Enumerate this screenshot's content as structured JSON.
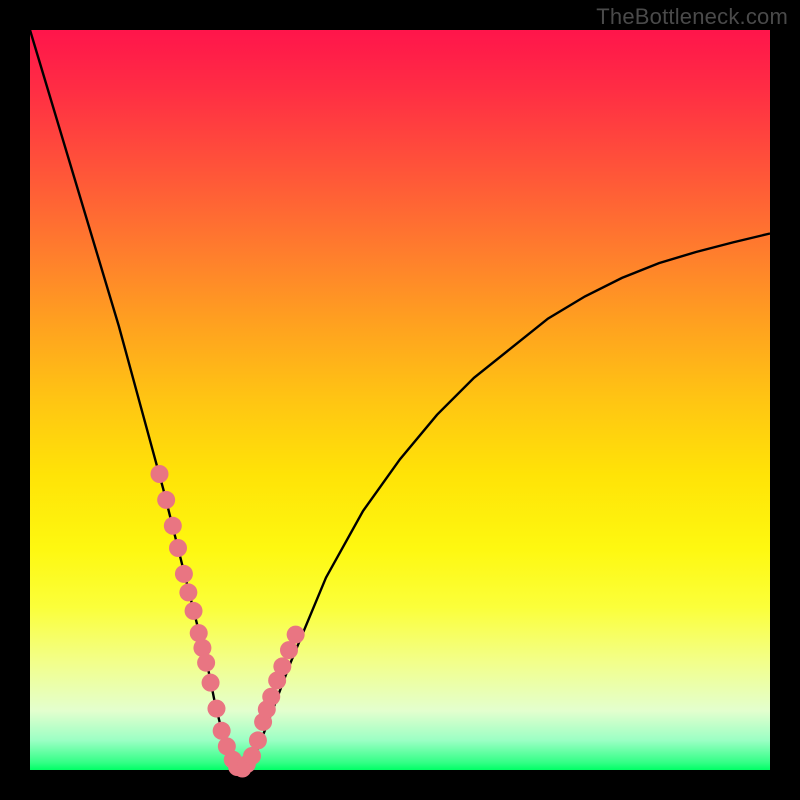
{
  "watermark": "TheBottleneck.com",
  "chart_data": {
    "type": "line",
    "title": "",
    "xlabel": "",
    "ylabel": "",
    "xlim": [
      0,
      100
    ],
    "ylim": [
      0,
      100
    ],
    "curve": {
      "x": [
        0,
        3,
        6,
        9,
        12,
        15,
        18,
        20,
        22,
        24,
        25,
        26,
        27,
        28,
        29,
        30,
        32,
        35,
        40,
        45,
        50,
        55,
        60,
        65,
        70,
        75,
        80,
        85,
        90,
        95,
        100
      ],
      "y": [
        100,
        90,
        80,
        70,
        60,
        49,
        38,
        30,
        22,
        14,
        9,
        5,
        2,
        0,
        0,
        1,
        6,
        14,
        26,
        35,
        42,
        48,
        53,
        57,
        61,
        64,
        66.5,
        68.5,
        70,
        71.3,
        72.5
      ]
    },
    "markers": {
      "x": [
        17.5,
        18.4,
        19.3,
        20.0,
        20.8,
        21.4,
        22.1,
        22.8,
        23.3,
        23.8,
        24.4,
        25.2,
        25.9,
        26.6,
        27.4,
        28.0,
        28.7,
        29.3,
        30.0,
        30.8,
        31.5,
        32.0,
        32.6,
        33.4,
        34.1,
        35.0,
        35.9
      ],
      "y": [
        40.0,
        36.5,
        33.0,
        30.0,
        26.5,
        24.0,
        21.5,
        18.5,
        16.5,
        14.5,
        11.8,
        8.3,
        5.3,
        3.2,
        1.4,
        0.4,
        0.2,
        0.8,
        1.9,
        4.0,
        6.5,
        8.2,
        9.9,
        12.1,
        14.0,
        16.2,
        18.3
      ],
      "radius": 9,
      "color": "#e97582"
    },
    "colors": {
      "curve": "#000000",
      "gradient_top": "#ff154b",
      "gradient_bottom": "#00ff66"
    }
  }
}
